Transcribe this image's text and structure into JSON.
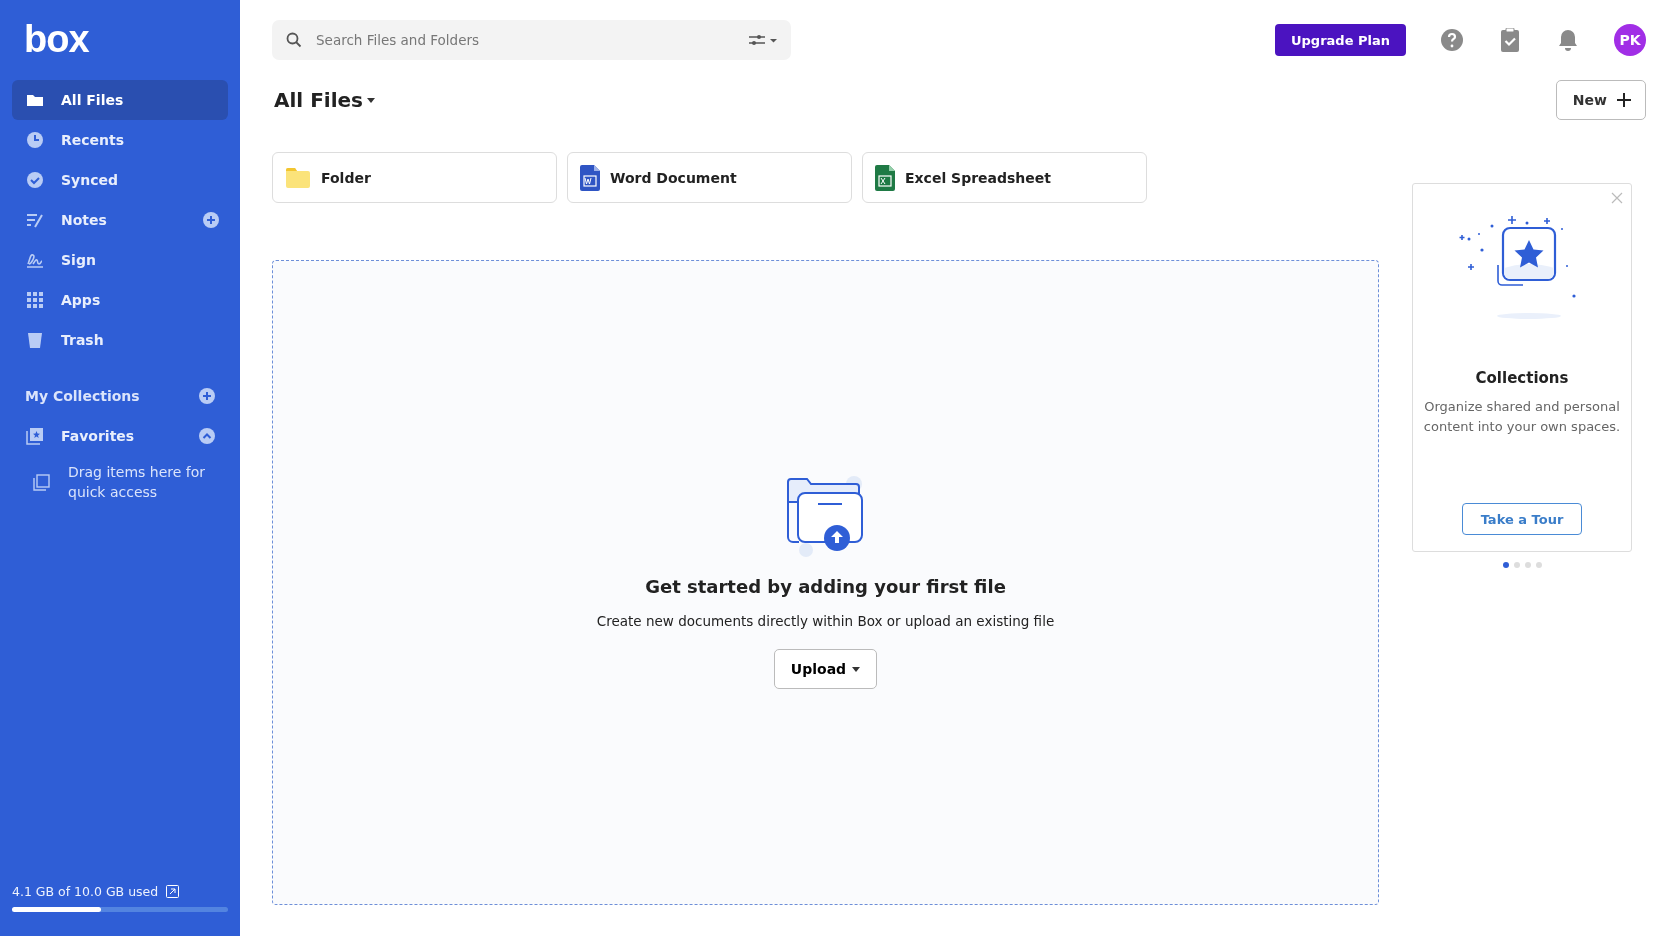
{
  "sidebar": {
    "logo": "box",
    "items": [
      {
        "kind": "nav",
        "label": "All Files",
        "selected": true
      },
      {
        "kind": "nav",
        "label": "Recents",
        "selected": false
      },
      {
        "kind": "nav",
        "label": "Synced",
        "selected": false
      },
      {
        "kind": "nav_add",
        "label": "Notes",
        "selected": false
      },
      {
        "kind": "nav",
        "label": "Sign",
        "selected": false
      },
      {
        "kind": "nav",
        "label": "Apps",
        "selected": false
      },
      {
        "kind": "nav",
        "label": "Trash",
        "selected": false
      }
    ],
    "collections": {
      "title": "My Collections",
      "favorites": {
        "label": "Favorites",
        "expanded": true,
        "hint": "Drag items here for quick access"
      }
    },
    "storage": {
      "text": "4.1 GB of 10.0 GB used",
      "level": 0.41
    }
  },
  "topbar": {
    "search": {
      "placeholder": "Search Files and Folders"
    },
    "upgrade_button": "Upgrade Plan",
    "avatar": "PK"
  },
  "header": {
    "title": "All Files",
    "new_button": "New"
  },
  "create_cards": [
    {
      "kind": "folder",
      "label": "Folder"
    },
    {
      "kind": "word",
      "label": "Word Document"
    },
    {
      "kind": "excel",
      "label": "Excel Spreadsheet"
    }
  ],
  "empty_state": {
    "title": "Get started by adding your first file",
    "text": "Create new documents directly within Box or upload an existing file",
    "upload_button": "Upload"
  },
  "promo": {
    "title": "Collections",
    "text": "Organize shared and personal content into your own spaces.",
    "button": "Take a Tour",
    "dots": [
      {
        "selected": true
      },
      {
        "selected": false
      },
      {
        "selected": false
      },
      {
        "selected": false
      }
    ]
  }
}
